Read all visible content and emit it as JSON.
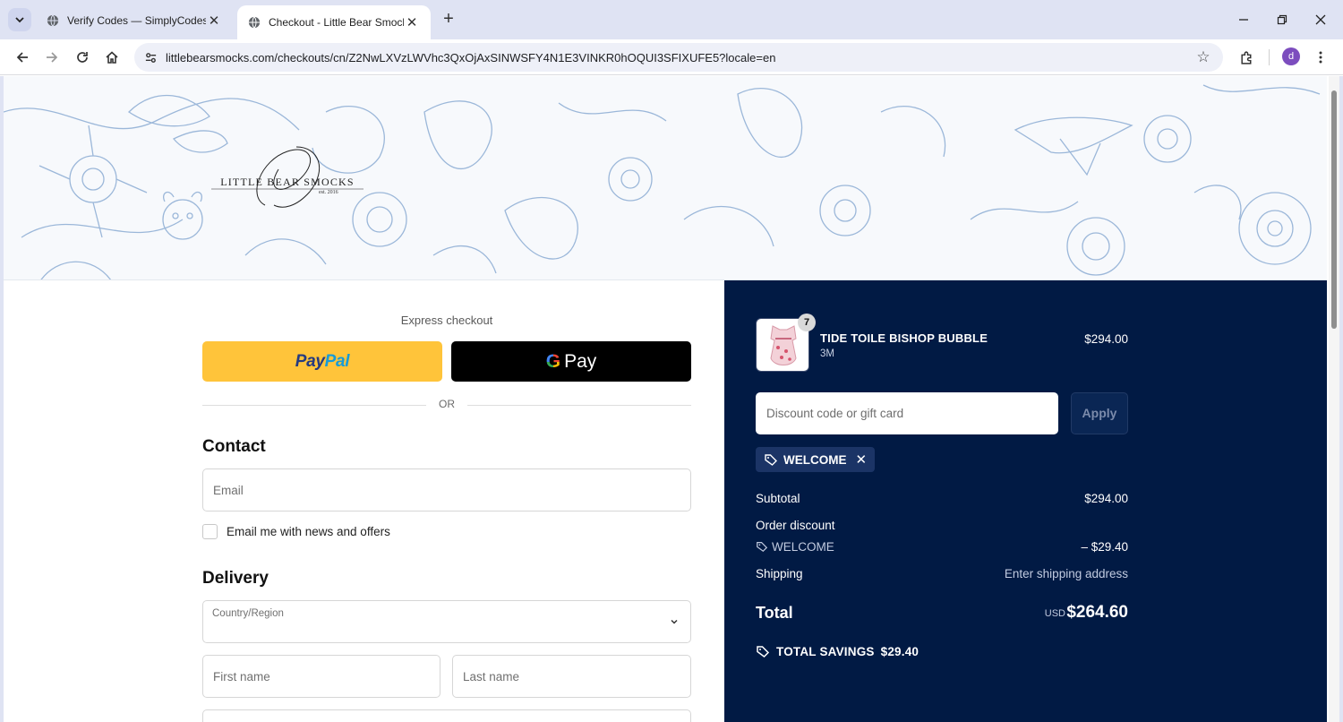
{
  "browser": {
    "tabs": [
      {
        "title": "Verify Codes — SimplyCodes"
      },
      {
        "title": "Checkout - Little Bear Smocks"
      }
    ],
    "url": "littlebearsmocks.com/checkouts/cn/Z2NwLXVzLWVhc3QxOjAxSINWSFY4N1E3VINKR0hOQUI3SFIXUFE5?locale=en",
    "avatar_initial": "d"
  },
  "header": {
    "logo_text": "LITTLE BEAR SMOCKS",
    "logo_est": "est. 2016"
  },
  "checkout": {
    "express_label": "Express checkout",
    "paypal_a": "Pay",
    "paypal_b": "Pal",
    "gpay_label": "Pay",
    "or_label": "OR",
    "contact_title": "Contact",
    "email_placeholder": "Email",
    "newsletter_label": "Email me with news and offers",
    "delivery_title": "Delivery",
    "country_label": "Country/Region",
    "first_name_placeholder": "First name",
    "last_name_placeholder": "Last name"
  },
  "summary": {
    "product": {
      "name": "TIDE TOILE BISHOP BUBBLE",
      "variant": "3M",
      "price": "$294.00",
      "quantity": "7"
    },
    "discount_placeholder": "Discount code or gift card",
    "apply_label": "Apply",
    "applied_code": "WELCOME",
    "subtotal_label": "Subtotal",
    "subtotal_value": "$294.00",
    "order_discount_label": "Order discount",
    "discount_code": "WELCOME",
    "discount_value": "– $29.40",
    "shipping_label": "Shipping",
    "shipping_value": "Enter shipping address",
    "total_label": "Total",
    "currency": "USD",
    "total_value": "$264.60",
    "savings_label": "TOTAL SAVINGS",
    "savings_value": "$29.40"
  },
  "colors": {
    "summary_bg": "#011a44",
    "paypal_yellow": "#ffc43a",
    "banner_ink": "#9bb7d9"
  }
}
